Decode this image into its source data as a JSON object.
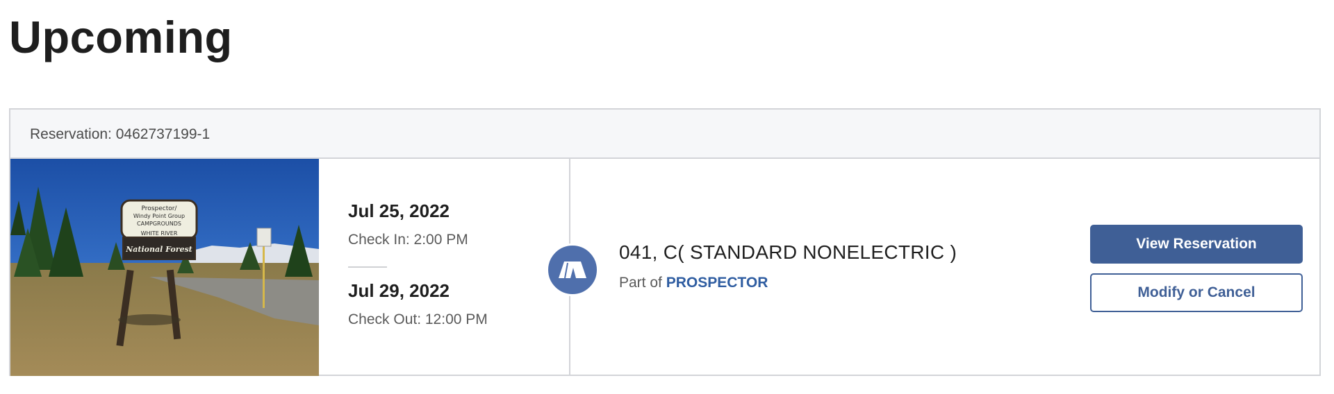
{
  "page": {
    "title": "Upcoming"
  },
  "reservation": {
    "label": "Reservation: 0462737199-1",
    "photo": {
      "sign_lines": [
        "Prospector/",
        "Windy Point Group",
        "CAMPGROUNDS",
        "WHITE RIVER",
        "National Forest"
      ]
    },
    "check_in": {
      "date": "Jul 25, 2022",
      "time": "Check In: 2:00 PM"
    },
    "check_out": {
      "date": "Jul 29, 2022",
      "time": "Check Out: 12:00 PM"
    },
    "site": {
      "icon": "tent-icon",
      "name": "041, C( STANDARD NONELECTRIC )",
      "part_of_prefix": "Part of",
      "park_name": "PROSPECTOR"
    },
    "actions": {
      "view_label": "View Reservation",
      "modify_label": "Modify or Cancel"
    }
  },
  "colors": {
    "accent": "#3f5f96",
    "icon_bg": "#4f6fac",
    "link": "#2f5da1",
    "header_bg": "#f6f7f9",
    "border": "#d2d4d8"
  }
}
